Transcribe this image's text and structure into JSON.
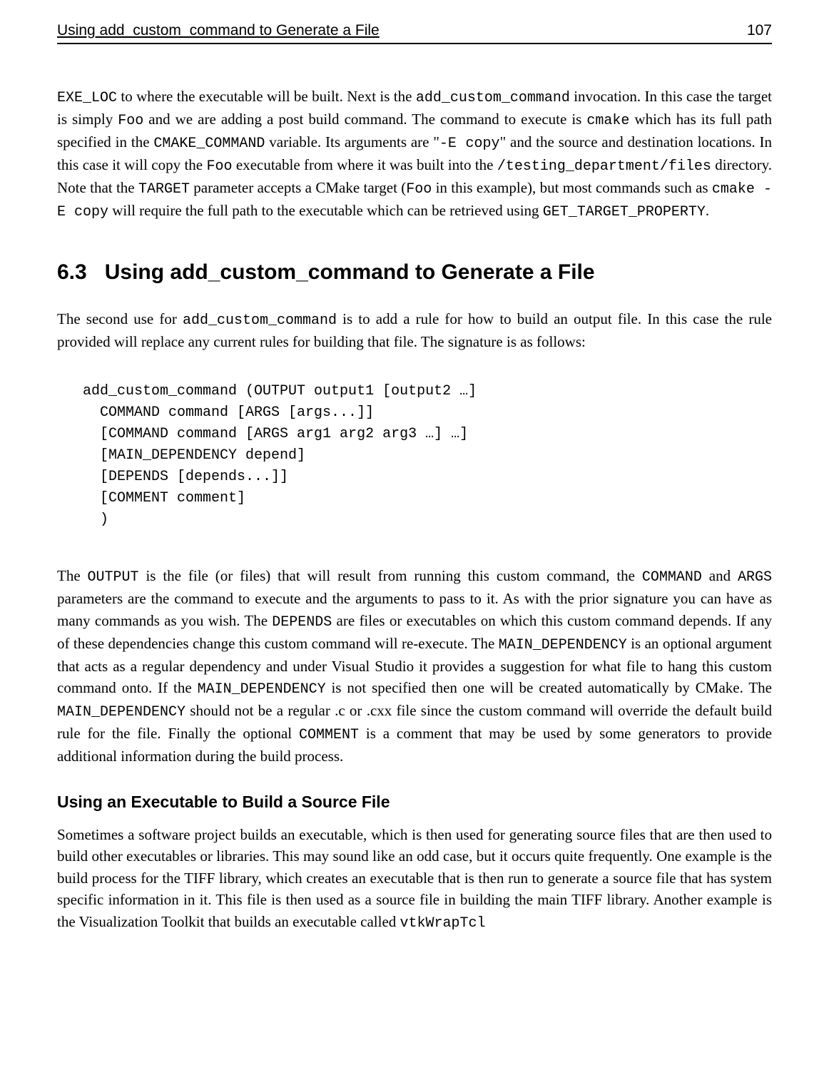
{
  "header": {
    "title": "Using add_custom_command to Generate a File",
    "page": "107"
  },
  "para1": {
    "pre": "EXE_LOC",
    "t1": " to where the executable will be built. Next is the ",
    "c1": "add_custom_command",
    "t2": " invocation. In this case the target is simply ",
    "c2": "Foo",
    "t3": " and we are adding a post build command. The command to execute is ",
    "c3": "cmake",
    "t4": " which has its full path specified in the ",
    "c4": "CMAKE_COMMAND",
    "t5": " variable. Its arguments are \"",
    "c5": "-E copy",
    "t6": "\" and the source and destination locations. In this case it will copy the ",
    "c6": "Foo",
    "t7": " executable from where it was built into the ",
    "c7": "/testing_department/files",
    "t8": " directory. Note that the ",
    "c8": "TARGET",
    "t9": " parameter accepts a CMake target (",
    "c9": "Foo",
    "t10": " in this example), but most commands such as ",
    "c10": "cmake -E copy",
    "t11": " will require the full path to the executable which can be retrieved using ",
    "c11": "GET_TARGET_PROPERTY",
    "t12": "."
  },
  "section": {
    "number": "6.3",
    "title": "Using add_custom_command to Generate a File"
  },
  "para2": {
    "t1": "The second use for ",
    "c1": "add_custom_command",
    "t2": " is to add a rule for how to build an output file. In this case the rule provided will replace any current rules for building that file. The signature is as follows:"
  },
  "code": "add_custom_command (OUTPUT output1 [output2 …]\n  COMMAND command [ARGS [args...]]\n  [COMMAND command [ARGS arg1 arg2 arg3 …] …]\n  [MAIN_DEPENDENCY depend]\n  [DEPENDS [depends...]]\n  [COMMENT comment]\n  )",
  "para3": {
    "t1": "The ",
    "c1": "OUTPUT",
    "t2": " is the file (or files) that will result from running this custom command, the ",
    "c2": "COMMAND",
    "t3": " and ",
    "c3": "ARGS",
    "t4": " parameters are the command to execute and the arguments to pass to it. As with the prior signature you can have as many commands as you wish. The ",
    "c4": "DEPENDS",
    "t5": " are files or executables on which this custom command depends. If any of these dependencies change this custom command will re-execute. The ",
    "c5": "MAIN_DEPENDENCY",
    "t6": " is an optional argument that acts as a regular dependency and under Visual Studio it provides a suggestion for what file to hang this custom command onto. If the ",
    "c6": "MAIN_DEPENDENCY",
    "t7": " is not specified then one will be created automatically by CMake. The ",
    "c7": "MAIN_DEPENDENCY",
    "t8": " should not be a regular .c or .cxx file since the custom command will override the default build rule for the file. Finally the optional ",
    "c8": "COMMENT",
    "t9": " is a comment that may be used by some generators to provide additional information during the build process."
  },
  "subsection": "Using an Executable to Build a Source File",
  "para4": {
    "t1": "Sometimes a software project builds an executable, which is then used for generating source files that are then used to build other executables or libraries. This may sound like an odd case, but it occurs quite frequently. One example is the build process for the TIFF library, which creates an executable that is then run to generate a source file that has system specific information in it. This file is then used as a source file in building the main TIFF library. Another example is the Visualization Toolkit that builds an executable called ",
    "c1": "vtkWrapTcl"
  }
}
